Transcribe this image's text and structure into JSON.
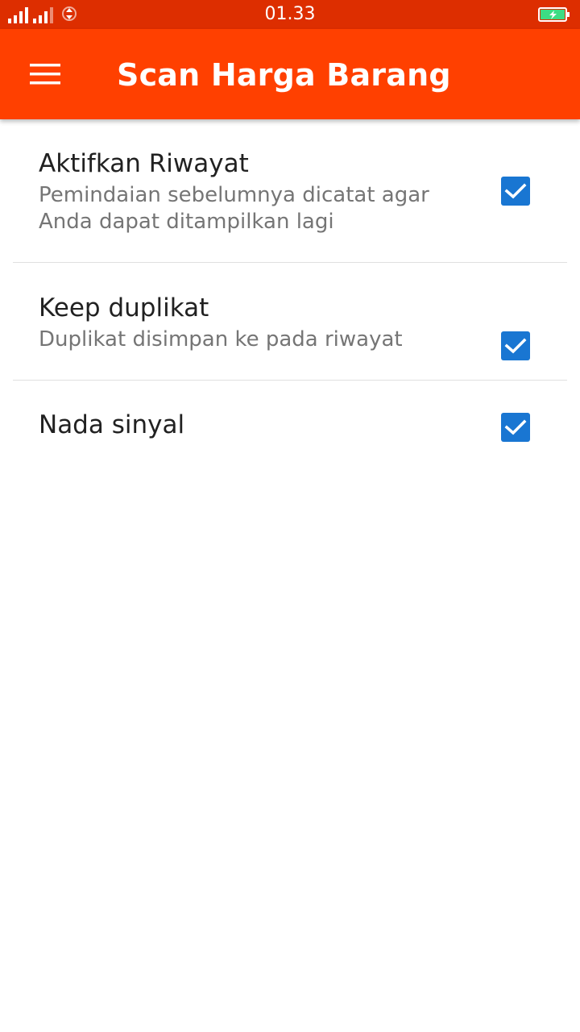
{
  "status_bar": {
    "time": "01.33"
  },
  "app_bar": {
    "title": "Scan Harga Barang",
    "menu_icon": "hamburger-menu-icon"
  },
  "preferences": [
    {
      "title": "Aktifkan Riwayat",
      "summary": "Pemindaian sebelumnya dicatat agar Anda dapat ditampilkan lagi",
      "checked": true
    },
    {
      "title": "Keep duplikat",
      "summary": "Duplikat disimpan ke pada riwayat",
      "checked": true
    },
    {
      "title": "Nada sinyal",
      "checked": true
    }
  ],
  "colors": {
    "status_bar": "#dd2e00",
    "app_bar": "#ff4000",
    "checkbox": "#1976d2",
    "battery_fill": "#3ddc84"
  }
}
